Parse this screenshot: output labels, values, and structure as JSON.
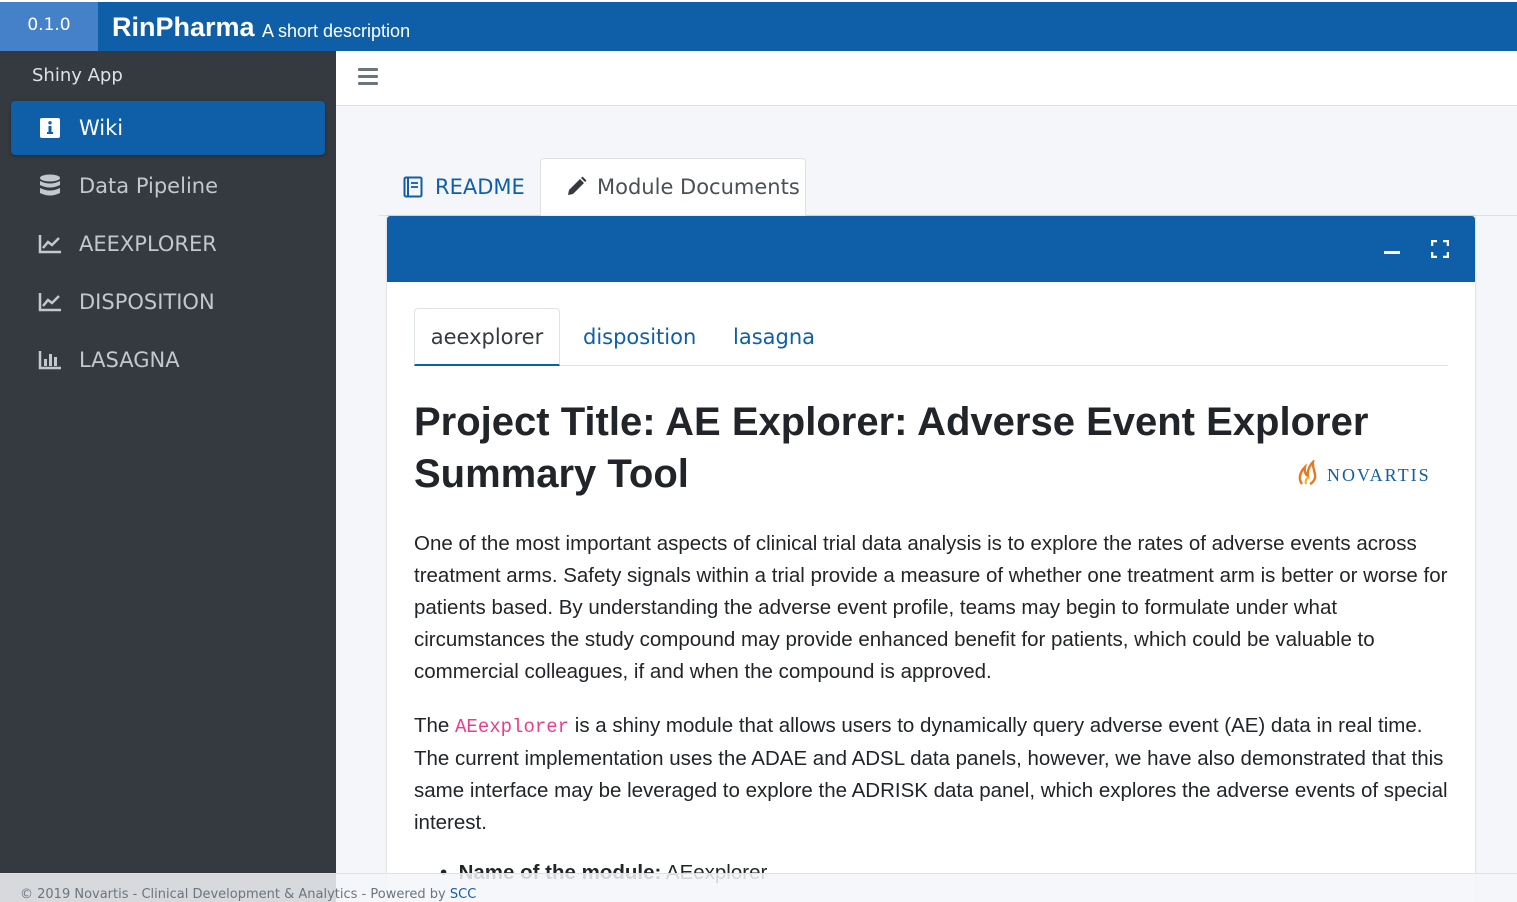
{
  "header": {
    "version": "0.1.0",
    "brand": "RinPharma",
    "description": "A short description"
  },
  "sidebar": {
    "title": "Shiny App",
    "items": [
      {
        "label": "Wiki",
        "icon": "info-icon",
        "active": true
      },
      {
        "label": "Data Pipeline",
        "icon": "database-icon",
        "active": false
      },
      {
        "label": "AEEXPLORER",
        "icon": "line-chart-icon",
        "active": false
      },
      {
        "label": "DISPOSITION",
        "icon": "line-chart-icon",
        "active": false
      },
      {
        "label": "LASAGNA",
        "icon": "bar-chart-icon",
        "active": false
      }
    ]
  },
  "main": {
    "tabs": [
      {
        "label": "README",
        "icon": "book-icon",
        "active": false
      },
      {
        "label": "Module Documents",
        "icon": "pencil-icon",
        "active": true
      }
    ],
    "card": {
      "tools": [
        "minimize-icon",
        "expand-icon"
      ],
      "subtabs": [
        {
          "label": "aeexplorer",
          "active": true
        },
        {
          "label": "disposition",
          "active": false
        },
        {
          "label": "lasagna",
          "active": false
        }
      ],
      "title": "Project Title: AE Explorer: Adverse Event Explorer Summary Tool",
      "logo_text": "NOVARTIS",
      "paragraph1": "One of the most important aspects of clinical trial data analysis is to explore the rates of adverse events across treatment arms. Safety signals within a trial provide a measure of whether one treatment arm is better or worse for patients based. By understanding the adverse event profile, teams may begin to formulate under what circumstances the study compound may provide enhanced benefit for patients, which could be valuable to commercial colleagues, if and when the compound is approved.",
      "paragraph2_pre": "The ",
      "paragraph2_code": "AEexplorer",
      "paragraph2_post": " is a shiny module that allows users to dynamically query adverse event (AE) data in real time. The current implementation uses the ADAE and ADSL data panels, however, we have also demonstrated that this same interface may be leveraged to explore the ADRISK data panel, which explores the adverse events of special interest.",
      "bullet_label": "Name of the module:",
      "bullet_value": " AEexplorer"
    }
  },
  "footer": {
    "text": "© 2019 Novartis - Clinical Development & Analytics - Powered by ",
    "link": "SCC"
  },
  "colors": {
    "primary": "#0f5fa8",
    "version_bg": "#4581c8",
    "sidebar_bg": "#343a40",
    "code": "#e83e8c"
  }
}
